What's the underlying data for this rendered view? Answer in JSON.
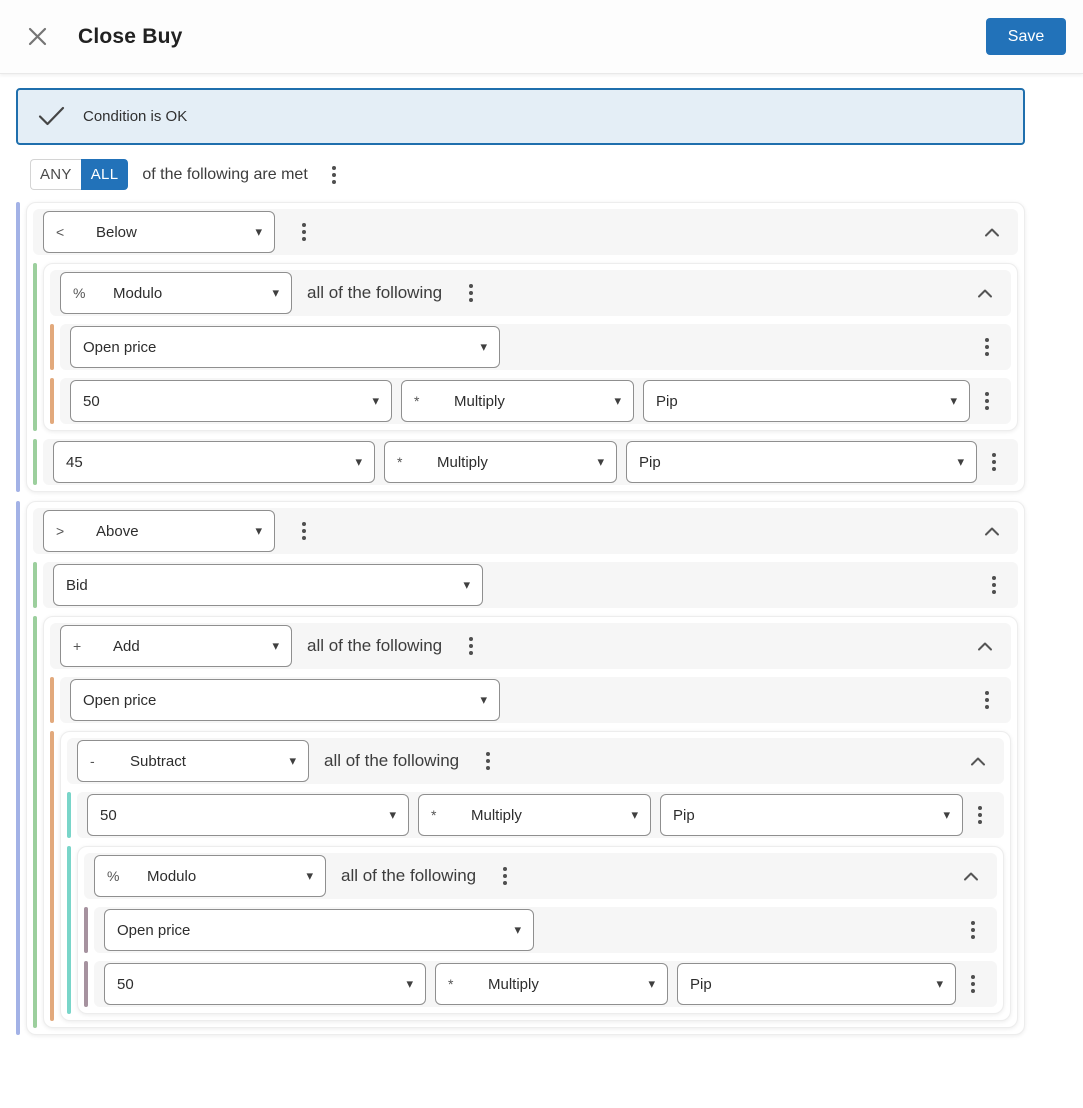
{
  "header": {
    "title": "Close Buy",
    "save_label": "Save"
  },
  "banner": {
    "text": "Condition is OK"
  },
  "root": {
    "any_label": "ANY",
    "all_label": "ALL",
    "selected": "ALL",
    "suffix": "of the following are met"
  },
  "colors": {
    "accent": "#2272b9",
    "banner_bg": "#e4eef6",
    "banner_border": "#1f6fad",
    "row_bg": "#f6f6f6",
    "bar_colors": [
      "#a3b2e6",
      "#9ccf9d",
      "#e2a97c",
      "#79d5c9",
      "#a6929f"
    ]
  },
  "icons": {
    "close": "x-icon",
    "status": "check-icon",
    "menu": "kebab-menu-icon",
    "collapse": "chevron-up-icon",
    "dropdown": "caret-down-icon"
  },
  "tree": [
    {
      "type": "group",
      "operator": {
        "symbol": "<",
        "label": "Below"
      },
      "suffix": "",
      "children": [
        {
          "type": "group",
          "operator": {
            "symbol": "%",
            "label": "Modulo"
          },
          "suffix": "all of the following",
          "children": [
            {
              "type": "row",
              "selects": [
                {
                  "kind": "wide",
                  "label": "Open price"
                }
              ]
            },
            {
              "type": "row",
              "selects": [
                {
                  "kind": "number",
                  "label": "50"
                },
                {
                  "kind": "mul",
                  "symbol": "*",
                  "label": "Multiply"
                },
                {
                  "kind": "pip",
                  "label": "Pip"
                }
              ]
            }
          ]
        },
        {
          "type": "row",
          "selects": [
            {
              "kind": "number",
              "label": "45"
            },
            {
              "kind": "mul",
              "symbol": "*",
              "label": "Multiply"
            },
            {
              "kind": "pip",
              "label": "Pip"
            }
          ]
        }
      ]
    },
    {
      "type": "group",
      "operator": {
        "symbol": ">",
        "label": "Above"
      },
      "suffix": "",
      "children": [
        {
          "type": "row",
          "selects": [
            {
              "kind": "wide",
              "label": "Bid"
            }
          ]
        },
        {
          "type": "group",
          "operator": {
            "symbol": "+",
            "label": "Add"
          },
          "suffix": "all of the following",
          "children": [
            {
              "type": "row",
              "selects": [
                {
                  "kind": "wide",
                  "label": "Open price"
                }
              ]
            },
            {
              "type": "group",
              "operator": {
                "symbol": "-",
                "label": "Subtract"
              },
              "suffix": "all of the following",
              "children": [
                {
                  "type": "row",
                  "selects": [
                    {
                      "kind": "number",
                      "label": "50"
                    },
                    {
                      "kind": "mul",
                      "symbol": "*",
                      "label": "Multiply"
                    },
                    {
                      "kind": "pip",
                      "label": "Pip"
                    }
                  ]
                },
                {
                  "type": "group",
                  "operator": {
                    "symbol": "%",
                    "label": "Modulo"
                  },
                  "suffix": "all of the following",
                  "children": [
                    {
                      "type": "row",
                      "selects": [
                        {
                          "kind": "wide",
                          "label": "Open price"
                        }
                      ]
                    },
                    {
                      "type": "row",
                      "selects": [
                        {
                          "kind": "number",
                          "label": "50"
                        },
                        {
                          "kind": "mul",
                          "symbol": "*",
                          "label": "Multiply"
                        },
                        {
                          "kind": "pip",
                          "label": "Pip"
                        }
                      ]
                    }
                  ]
                }
              ]
            }
          ]
        }
      ]
    }
  ]
}
